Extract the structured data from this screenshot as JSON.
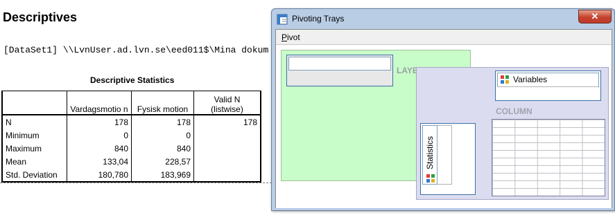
{
  "output": {
    "title": "Descriptives",
    "dataset_line": "[DataSet1] \\\\LvnUser.ad.lvn.se\\eed011$\\Mina dokum",
    "table": {
      "title": "Descriptive Statistics",
      "headers": [
        "",
        "Vardagsmotio n",
        "Fysisk motion",
        "Valid N (listwise)"
      ],
      "rows": [
        {
          "label": "N",
          "c1": "178",
          "c2": "178",
          "c3": "178"
        },
        {
          "label": "Minimum",
          "c1": "0",
          "c2": "0",
          "c3": ""
        },
        {
          "label": "Maximum",
          "c1": "840",
          "c2": "840",
          "c3": ""
        },
        {
          "label": "Mean",
          "c1": "133,04",
          "c2": "228,57",
          "c3": ""
        },
        {
          "label": "Std. Deviation",
          "c1": "180,780",
          "c2": "183,969",
          "c3": ""
        }
      ]
    }
  },
  "window": {
    "title": "Pivoting Trays",
    "close_glyph": "✕",
    "menu": {
      "pivot_label_first": "P",
      "pivot_label_rest": "ivot"
    },
    "layer_label": "LAYER",
    "column_label": "COLUMN",
    "column_item": "Variables",
    "row_item": "Statistics",
    "icons": {
      "app": "pivot-tray-icon",
      "variable": "pivot-item-icon"
    }
  },
  "colors": {
    "layer_bg": "#c8fcc8",
    "pivot_bg": "#dcdcf0",
    "window_frame": "#b9cde5",
    "close_button": "#c0392b"
  }
}
